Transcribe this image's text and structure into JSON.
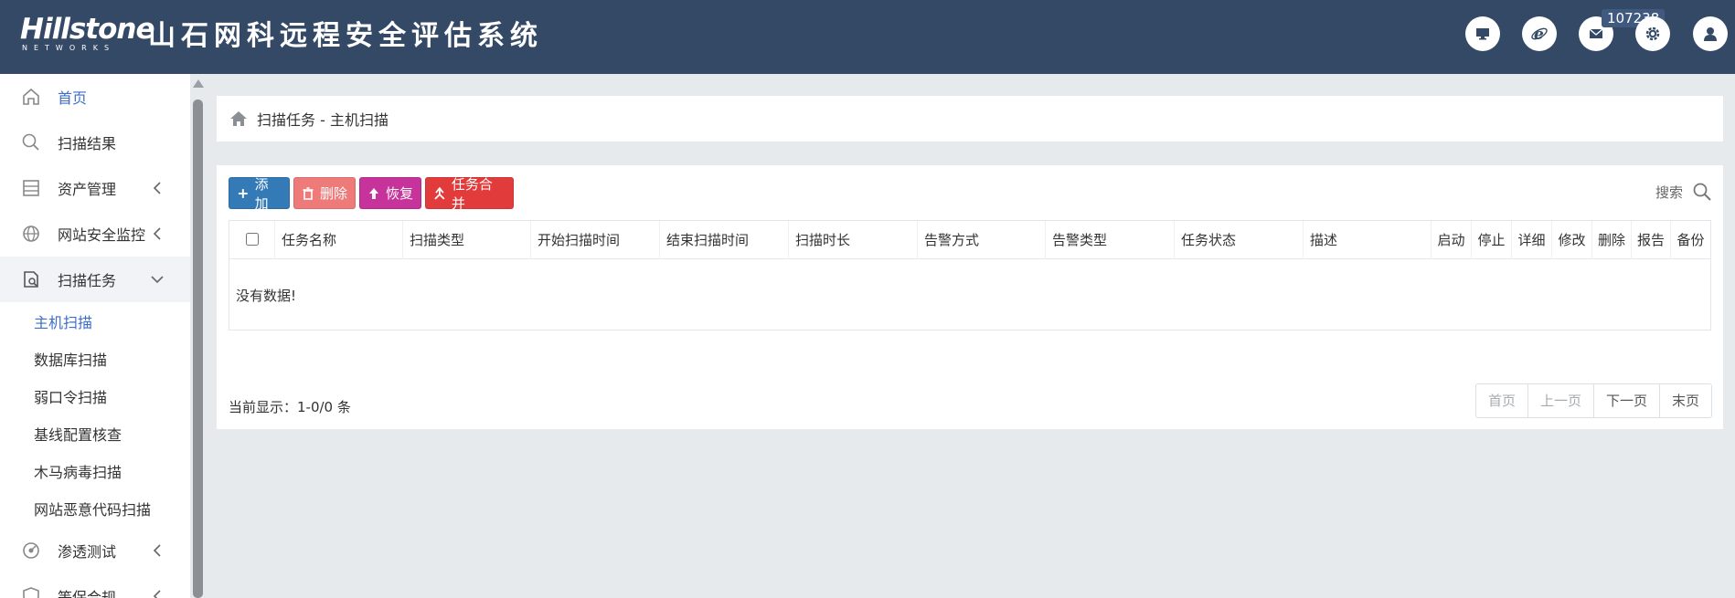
{
  "header": {
    "logo_brand": "Hillstone",
    "logo_sub": "NETWORKS",
    "title": "山石网科远程安全评估系统",
    "badge_count": "107238",
    "icons": [
      "monitor-icon",
      "ie-browser-icon",
      "mail-icon",
      "gear-icon",
      "user-icon"
    ]
  },
  "sidebar": {
    "items": [
      {
        "label": "首页",
        "icon": "home-icon"
      },
      {
        "label": "扫描结果",
        "icon": "search-icon"
      },
      {
        "label": "资产管理",
        "icon": "server-icon"
      },
      {
        "label": "网站安全监控",
        "icon": "globe-icon"
      },
      {
        "label": "扫描任务",
        "icon": "scan-task-icon"
      },
      {
        "label": "渗透测试",
        "icon": "pentest-icon"
      },
      {
        "label": "等保合规",
        "icon": "shield-icon"
      }
    ],
    "sub_items": [
      {
        "label": "主机扫描"
      },
      {
        "label": "数据库扫描"
      },
      {
        "label": "弱口令扫描"
      },
      {
        "label": "基线配置核查"
      },
      {
        "label": "木马病毒扫描"
      },
      {
        "label": "网站恶意代码扫描"
      }
    ]
  },
  "breadcrumb": {
    "text": "扫描任务 - 主机扫描"
  },
  "toolbar": {
    "add_label": "添加",
    "delete_label": "删除",
    "restore_label": "恢复",
    "merge_label": "任务合并",
    "search_label": "搜索"
  },
  "table": {
    "columns": [
      "任务名称",
      "扫描类型",
      "开始扫描时间",
      "结束扫描时间",
      "扫描时长",
      "告警方式",
      "告警类型",
      "任务状态",
      "描述",
      "启动",
      "停止",
      "详细",
      "修改",
      "删除",
      "报告",
      "备份"
    ],
    "empty_text": "没有数据!"
  },
  "footer": {
    "info": "当前显示：1-0/0 条"
  },
  "pager": {
    "first": "首页",
    "prev": "上一页",
    "next": "下一页",
    "last": "末页"
  },
  "colors": {
    "header_bg": "#344966",
    "accent_blue": "#3d6ec9",
    "btn_add": "#337ab7",
    "btn_delete": "#ee7a7a",
    "btn_restore": "#c6339a",
    "btn_merge": "#e23b3b"
  }
}
